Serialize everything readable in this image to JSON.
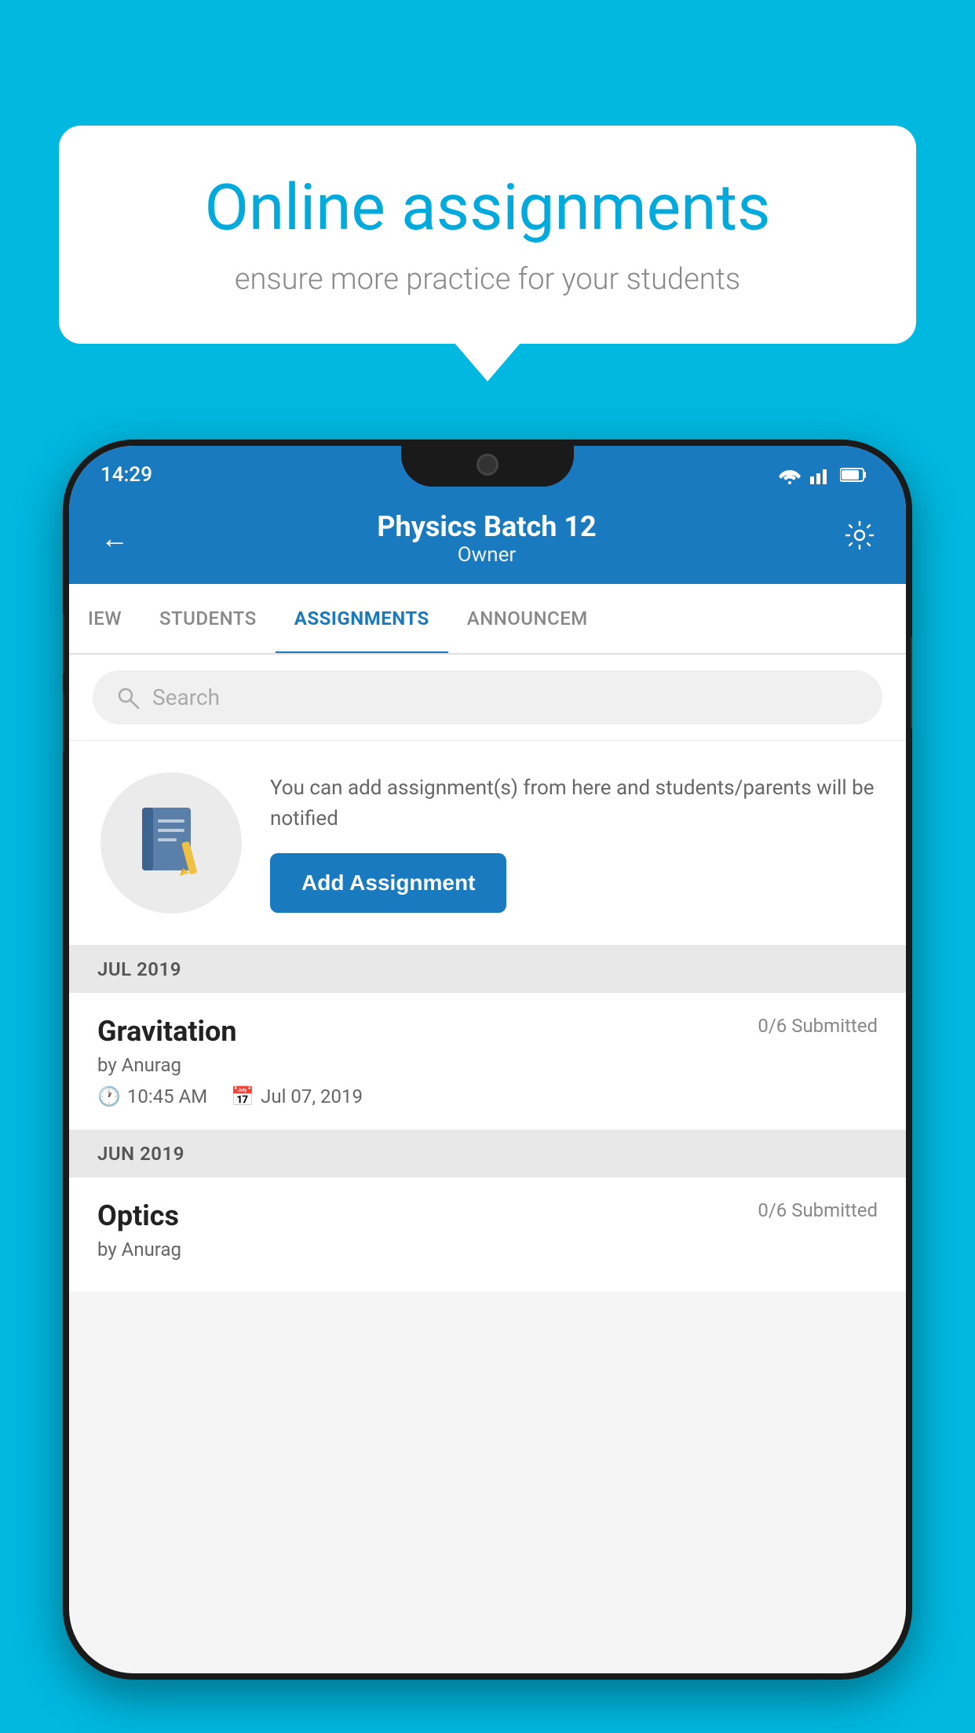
{
  "page": {
    "background_color": "#00b8e0"
  },
  "speech_bubble": {
    "title": "Online assignments",
    "subtitle": "ensure more practice for your students"
  },
  "status_bar": {
    "time": "14:29",
    "icons": [
      "wifi",
      "signal",
      "battery"
    ]
  },
  "header": {
    "title": "Physics Batch 12",
    "subtitle": "Owner",
    "back_label": "←",
    "settings_label": "⚙"
  },
  "tabs": [
    {
      "label": "IEW",
      "active": false
    },
    {
      "label": "STUDENTS",
      "active": false
    },
    {
      "label": "ASSIGNMENTS",
      "active": true
    },
    {
      "label": "ANNOUNCEM",
      "active": false
    }
  ],
  "search": {
    "placeholder": "Search"
  },
  "add_assignment_card": {
    "description": "You can add assignment(s) from here and students/parents will be notified",
    "button_label": "Add Assignment"
  },
  "sections": [
    {
      "label": "JUL 2019",
      "assignments": [
        {
          "name": "Gravitation",
          "submitted": "0/6 Submitted",
          "author": "by Anurag",
          "time": "10:45 AM",
          "date": "Jul 07, 2019"
        }
      ]
    },
    {
      "label": "JUN 2019",
      "assignments": [
        {
          "name": "Optics",
          "submitted": "0/6 Submitted",
          "author": "by Anurag",
          "time": "",
          "date": ""
        }
      ]
    }
  ]
}
